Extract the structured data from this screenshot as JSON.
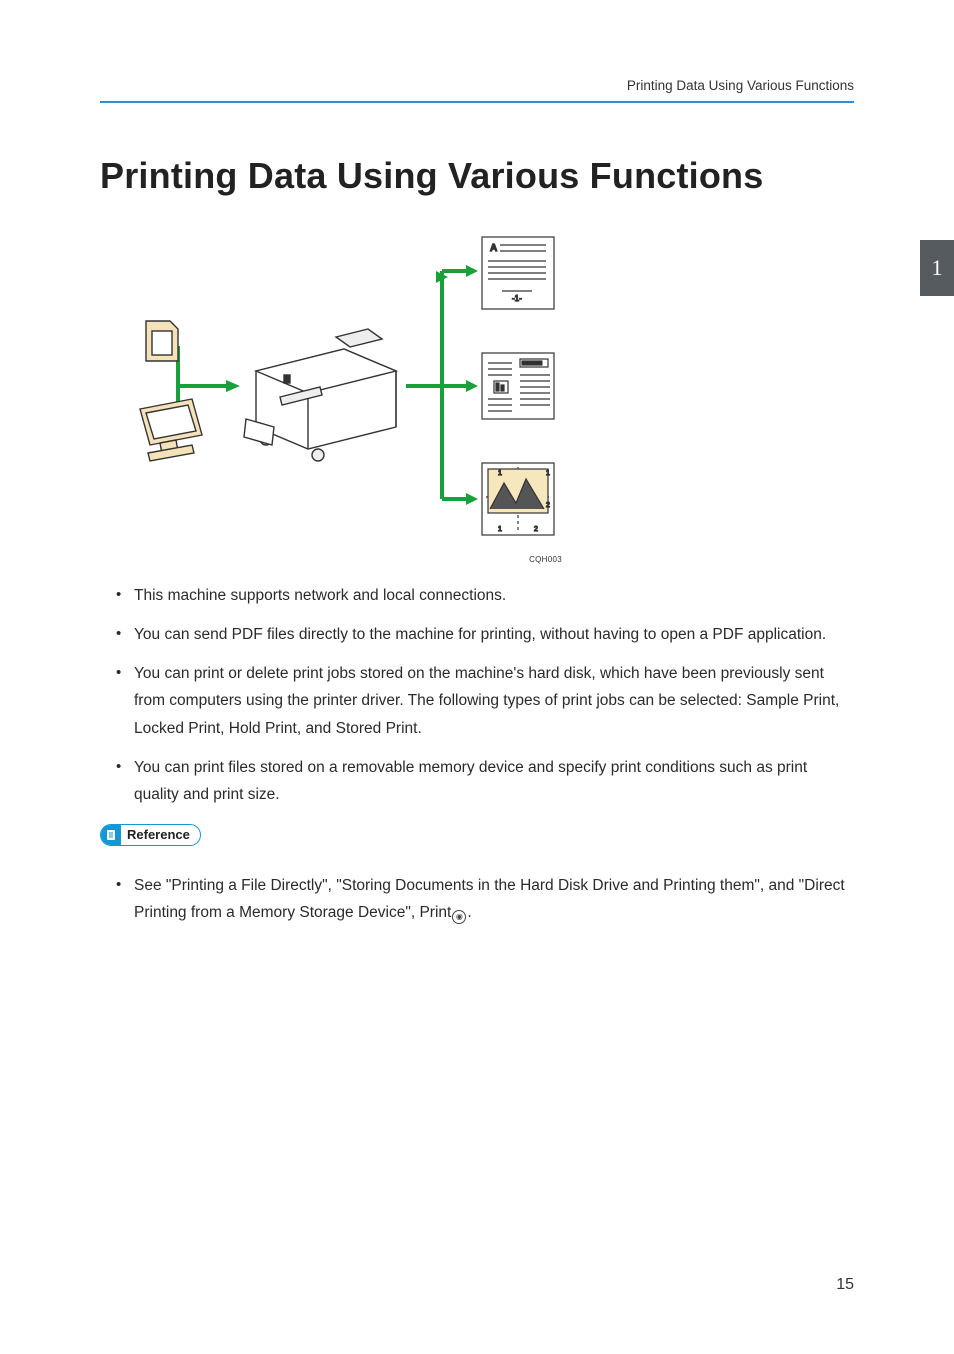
{
  "header": {
    "running_title": "Printing Data Using Various Functions"
  },
  "section_tab": "1",
  "title": "Printing Data Using Various Functions",
  "figure": {
    "caption": "CQH003",
    "doc_label_a": "A",
    "doc_label_page": "-1-"
  },
  "bullets": [
    "This machine supports network and local connections.",
    "You can send PDF files directly to the machine for printing, without having to open a PDF application.",
    "You can print or delete print jobs stored on the machine's hard disk, which have been previously sent from computers using the printer driver. The following types of print jobs can be selected: Sample Print, Locked Print, Hold Print, and Stored Print.",
    "You can print files stored on a removable memory device and specify print conditions such as print quality and print size."
  ],
  "reference": {
    "label": "Reference",
    "item_prefix": "See \"Printing a File Directly\", \"Storing Documents in the Hard Disk Drive and Printing them\", and \"Direct Printing from a Memory Storage Device\", Print",
    "item_suffix": "."
  },
  "page_number": "15"
}
